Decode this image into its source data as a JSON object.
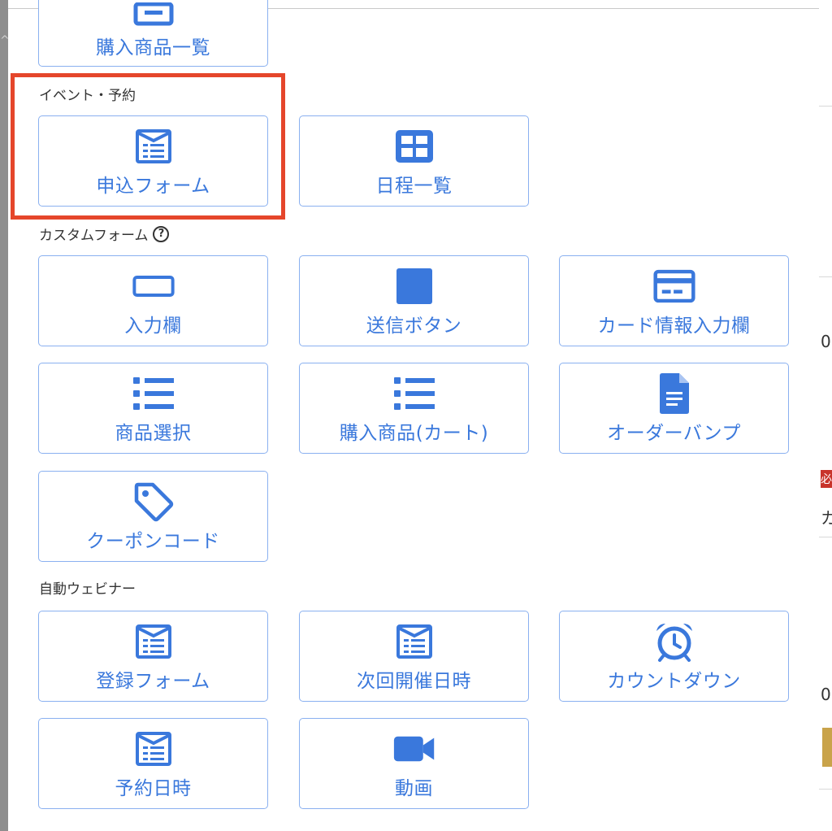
{
  "colors": {
    "accent": "#3a78dc",
    "tile_border": "#8ab0f0",
    "highlight": "#e5462b"
  },
  "background": {
    "right_text_1": "0",
    "right_text_2": "必",
    "right_text_3": "カ",
    "right_text_4": "0"
  },
  "top_partial": {
    "label": "購入商品一覧",
    "icon": "list-box-icon"
  },
  "sections": {
    "event": {
      "title": "イベント・予約"
    },
    "custom": {
      "title": "カスタムフォーム",
      "help": "?"
    },
    "webinar": {
      "title": "自動ウェビナー"
    }
  },
  "tiles": {
    "apply_form": {
      "label": "申込フォーム",
      "icon": "form-icon"
    },
    "schedule_list": {
      "label": "日程一覧",
      "icon": "grid-icon"
    },
    "input_field": {
      "label": "入力欄",
      "icon": "input-box-icon"
    },
    "submit_button": {
      "label": "送信ボタン",
      "icon": "square-icon"
    },
    "card_input": {
      "label": "カード情報入力欄",
      "icon": "credit-card-icon"
    },
    "product_select": {
      "label": "商品選択",
      "icon": "list-icon"
    },
    "cart": {
      "label": "購入商品(カート)",
      "icon": "list-icon"
    },
    "order_bump": {
      "label": "オーダーバンプ",
      "icon": "document-icon"
    },
    "coupon": {
      "label": "クーポンコード",
      "icon": "tag-icon"
    },
    "register_form": {
      "label": "登録フォーム",
      "icon": "form-icon"
    },
    "next_datetime": {
      "label": "次回開催日時",
      "icon": "form-icon"
    },
    "countdown": {
      "label": "カウントダウン",
      "icon": "alarm-clock-icon"
    },
    "reserve_datetime": {
      "label": "予約日時",
      "icon": "form-icon"
    },
    "video": {
      "label": "動画",
      "icon": "video-camera-icon"
    }
  }
}
